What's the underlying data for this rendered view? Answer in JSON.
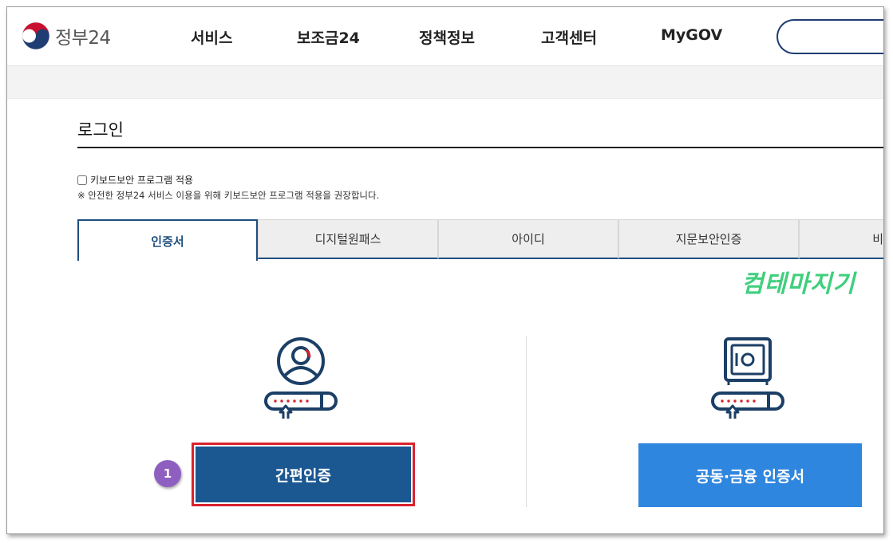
{
  "header": {
    "logo_text": "정부24",
    "nav": [
      "서비스",
      "보조금24",
      "정책정보",
      "고객센터",
      "MyGOV"
    ]
  },
  "page": {
    "title": "로그인",
    "keyboard_security_label": "키보드보안 프로그램 적용",
    "keyboard_note": "※ 안전한 정부24 서비스 이용을 위해 키보드보안 프로그램 적용을 권장합니다."
  },
  "tabs": [
    {
      "label": "인증서",
      "active": true
    },
    {
      "label": "디지털원패스",
      "active": false
    },
    {
      "label": "아이디",
      "active": false
    },
    {
      "label": "지문보안인증",
      "active": false
    },
    {
      "label": "비회원",
      "active": false
    }
  ],
  "watermark": "컴테마지기",
  "buttons": {
    "simple_auth": "간편인증",
    "joint_cert": "공동·금융 인증서"
  },
  "step_badge": "1",
  "colors": {
    "primary_navy": "#1b5791",
    "accent_blue": "#2f86df",
    "highlight_red": "#d9232e",
    "badge_purple": "#8e5fc0",
    "watermark_green": "#3fcf7d"
  }
}
